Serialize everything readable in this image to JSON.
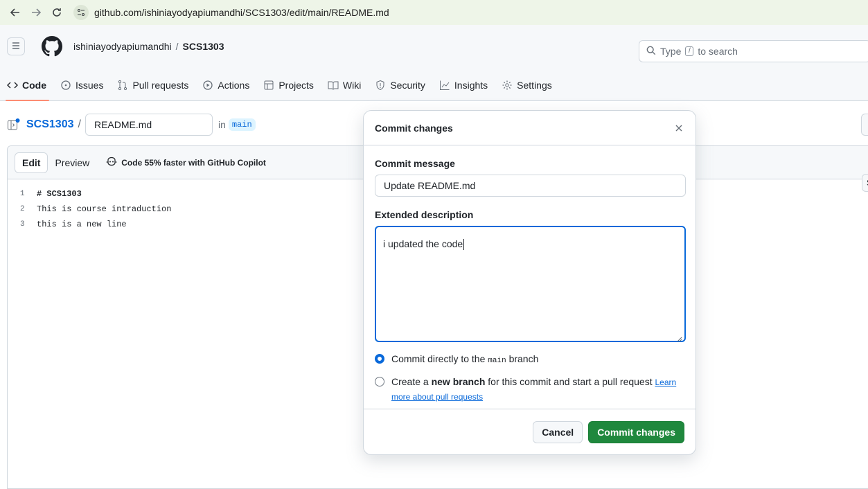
{
  "browser": {
    "url": "github.com/ishiniayodyapiumandhi/SCS1303/edit/main/README.md"
  },
  "header": {
    "owner": "ishiniayodyapiumandhi",
    "separator": "/",
    "repo": "SCS1303",
    "search_prefix": "Type",
    "search_key": "/",
    "search_suffix": "to search"
  },
  "tabs": [
    {
      "label": "Code",
      "icon": "code-icon"
    },
    {
      "label": "Issues",
      "icon": "issue-icon"
    },
    {
      "label": "Pull requests",
      "icon": "pull-request-icon"
    },
    {
      "label": "Actions",
      "icon": "play-icon"
    },
    {
      "label": "Projects",
      "icon": "table-icon"
    },
    {
      "label": "Wiki",
      "icon": "book-icon"
    },
    {
      "label": "Security",
      "icon": "shield-icon"
    },
    {
      "label": "Insights",
      "icon": "graph-icon"
    },
    {
      "label": "Settings",
      "icon": "gear-icon"
    }
  ],
  "file": {
    "repo_link": "SCS1303",
    "slash": "/",
    "filename": "README.md",
    "in_label": "in",
    "branch": "main"
  },
  "editor": {
    "edit_tab": "Edit",
    "preview_tab": "Preview",
    "copilot_text": "Code 55% faster with GitHub Copilot",
    "right_stub": "S",
    "lines": [
      {
        "num": "1",
        "text": "# SCS1303"
      },
      {
        "num": "2",
        "text": "This is course intraduction"
      },
      {
        "num": "3",
        "text": "this is a new line"
      }
    ]
  },
  "modal": {
    "title": "Commit changes",
    "commit_message_label": "Commit message",
    "commit_message_value": "Update README.md",
    "extended_label": "Extended description",
    "extended_value": "i updated the code",
    "option1_prefix": "Commit directly to the",
    "option1_branch": "main",
    "option1_suffix": "branch",
    "option2_prefix": "Create a",
    "option2_bold": "new branch",
    "option2_suffix": "for this commit and start a pull request",
    "option2_link": "Learn more about pull requests",
    "cancel_label": "Cancel",
    "commit_label": "Commit changes"
  }
}
